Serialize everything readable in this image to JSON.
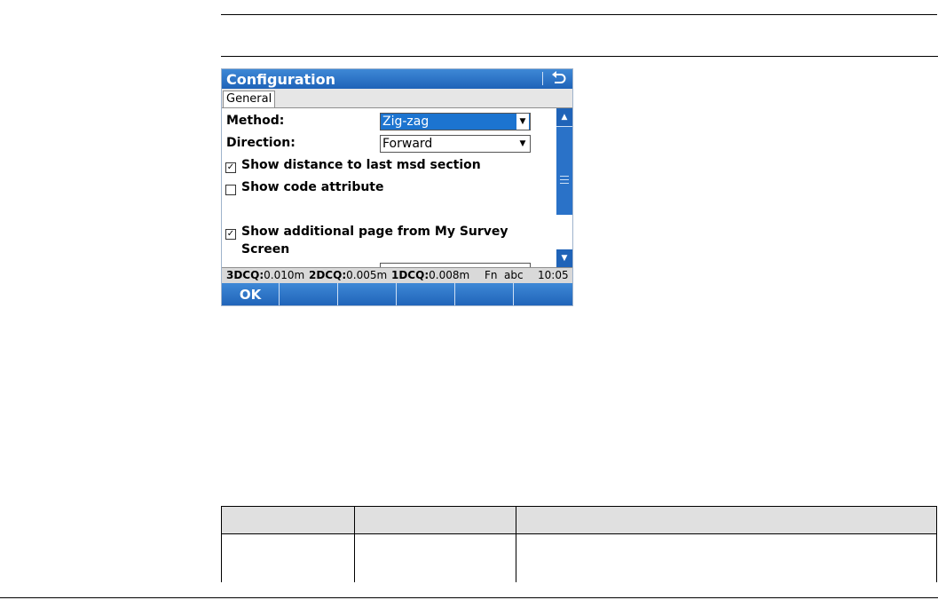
{
  "app": {
    "title": "Configuration",
    "back_icon": "back-arrow-icon",
    "tabs": [
      {
        "label": "General"
      }
    ]
  },
  "form": {
    "method_label": "Method:",
    "method_value": "Zig-zag",
    "direction_label": "Direction:",
    "direction_value": "Forward",
    "dropdown_icon": "dropdown-arrow-icon",
    "checks": [
      {
        "label": "Show distance to last msd section",
        "checked": true
      },
      {
        "label": "Show code attribute",
        "checked": false
      },
      {
        "label_line1": "Show additional page from My Survey",
        "label_line2": "Screen",
        "checked": true
      }
    ],
    "check_mark": "☑"
  },
  "status": {
    "q3_label": "3DCQ:",
    "q3_value": "0.010m",
    "q2_label": "2DCQ:",
    "q2_value": "0.005m",
    "q1_label": "1DCQ:",
    "q1_value": "0.008m",
    "fn": "Fn",
    "input_mode": "abc",
    "time": "10:05"
  },
  "softkeys": {
    "ok": "OK"
  },
  "colors": {
    "titlebar": "#1f63b8",
    "selection": "#1c74d0",
    "statusbar": "#d9d9d9"
  }
}
